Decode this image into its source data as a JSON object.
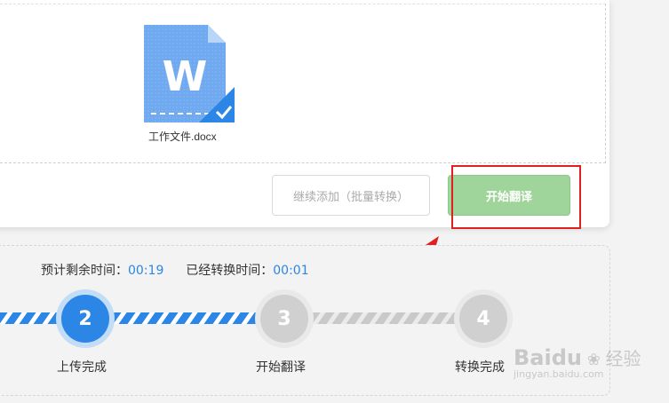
{
  "file": {
    "name": "工作文件.docx",
    "icon_letter": "W"
  },
  "buttons": {
    "continue_add": "继续添加（批量转换）",
    "start_translate": "开始翻译"
  },
  "timers": {
    "remaining_label": "预计剩余时间：",
    "remaining_value": "00:19",
    "elapsed_label": "已经转换时间：",
    "elapsed_value": "00:01"
  },
  "steps": [
    {
      "number": "2",
      "label": "上传完成",
      "state": "active"
    },
    {
      "number": "3",
      "label": "开始翻译",
      "state": "pending"
    },
    {
      "number": "4",
      "label": "转换完成",
      "state": "pending"
    }
  ],
  "watermark": {
    "brand": "Baidu",
    "suffix": "经验",
    "url": "jingyan.baidu.com"
  },
  "colors": {
    "accent_blue": "#2b86e6",
    "start_button_green": "#9fd59a",
    "highlight_red": "#e02020",
    "pending_gray": "#d0d0d0"
  }
}
